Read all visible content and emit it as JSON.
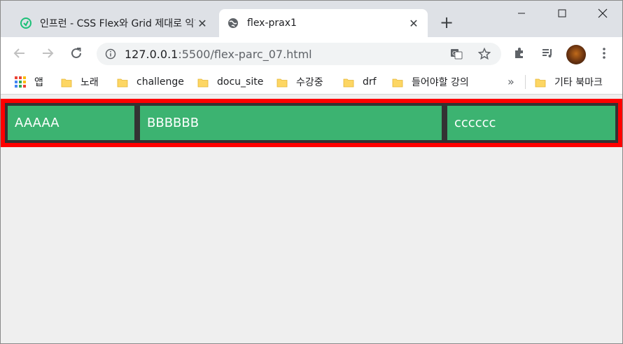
{
  "browser": {
    "tabs": [
      {
        "title": "인프런 - CSS Flex와 Grid 제대로 익히기",
        "active": false
      },
      {
        "title": "flex-prax1",
        "active": true
      }
    ],
    "address": {
      "host": "127.0.0.1",
      "rest": ":5500/flex-parc_07.html"
    },
    "bookmarks": [
      {
        "label": "앱",
        "icon": "apps-grid-icon"
      },
      {
        "label": "노래",
        "icon": "folder-icon"
      },
      {
        "label": "challenge",
        "icon": "folder-icon"
      },
      {
        "label": "docu_site",
        "icon": "folder-icon"
      },
      {
        "label": "수강중",
        "icon": "folder-icon"
      },
      {
        "label": "drf",
        "icon": "folder-icon"
      },
      {
        "label": "들어야할 강의",
        "icon": "folder-icon"
      }
    ],
    "overflow_chevron": "»",
    "other_bookmarks": "기타 북마크"
  },
  "page": {
    "items": [
      "AAAAA",
      "BBBBBB",
      "cccccc"
    ]
  },
  "colors": {
    "container_bg": "#ff0000",
    "item_bg": "#3cb371",
    "item_border": "#333333",
    "page_bg": "#efefef"
  }
}
